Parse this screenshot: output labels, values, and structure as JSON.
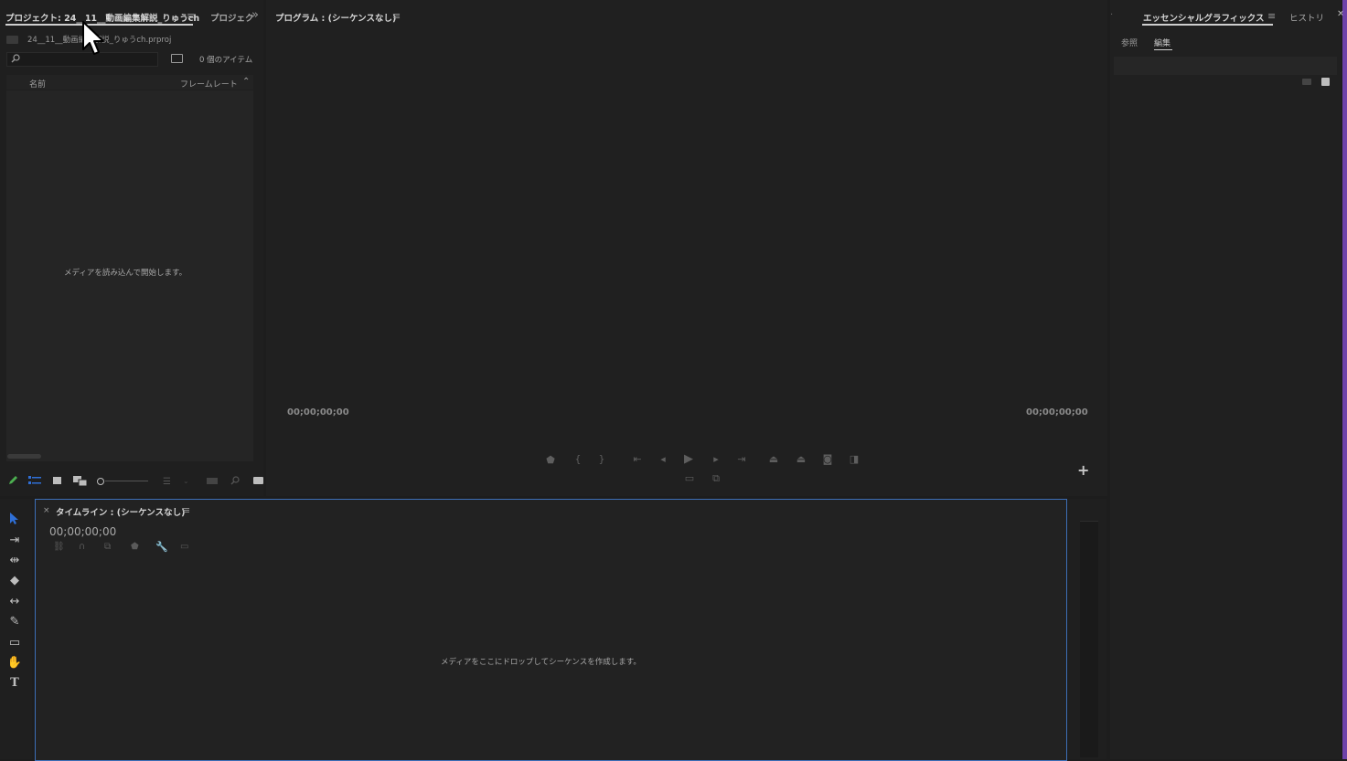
{
  "project_panel": {
    "tab_active": "プロジェクト: 24__11__動画編集解説_りゅうch",
    "tab_2": "プロジェク",
    "overflow": "»",
    "menu": "≡",
    "file_name": "24__11__動画編集解説_りゅうch.prproj",
    "item_count": "0 個のアイテム",
    "col_name": "名前",
    "col_framerate": "フレームレート",
    "empty_message": "メディアを読み込んで開始します。"
  },
  "program_monitor": {
    "title": "プログラム : (シーケンスなし)",
    "menu": "≡",
    "timecode_left": "00;00;00;00",
    "timecode_right": "00;00;00;00",
    "add_button": "+"
  },
  "essential_graphics": {
    "title": "エッセンシャルグラフィックス",
    "menu": "≡",
    "history_tab": "ヒストリ",
    "close": "✕",
    "dot": "·",
    "subtab_browse": "参照",
    "subtab_edit": "編集"
  },
  "timeline": {
    "close": "×",
    "title": "タイムライン : (シーケンスなし)",
    "menu": "≡",
    "timecode": "00;00;00;00",
    "empty_message": "メディアをここにドロップしてシーケンスを作成します。"
  },
  "colors": {
    "background": "#1d1d1d",
    "panel": "#232323",
    "focus_border": "#3d6fb8",
    "accent_purple": "#8a4fd8",
    "pen_green": "#4caf50",
    "select_blue": "#2f6fd6"
  }
}
